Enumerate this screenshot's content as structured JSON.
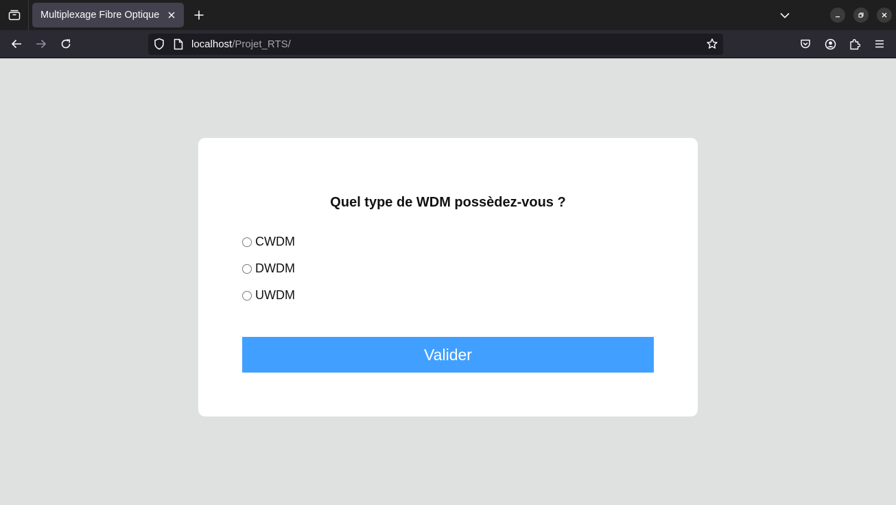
{
  "browser": {
    "tab_title": "Multiplexage Fibre Optique",
    "url_host": "localhost",
    "url_path": "/Projet_RTS/"
  },
  "form": {
    "question": "Quel type de WDM possèdez-vous ?",
    "options": [
      "CWDM",
      "DWDM",
      "UWDM"
    ],
    "submit_label": "Valider"
  },
  "colors": {
    "page_background": "#dfe0e0",
    "card_background": "#ffffff",
    "submit_button": "#41a0ff"
  }
}
